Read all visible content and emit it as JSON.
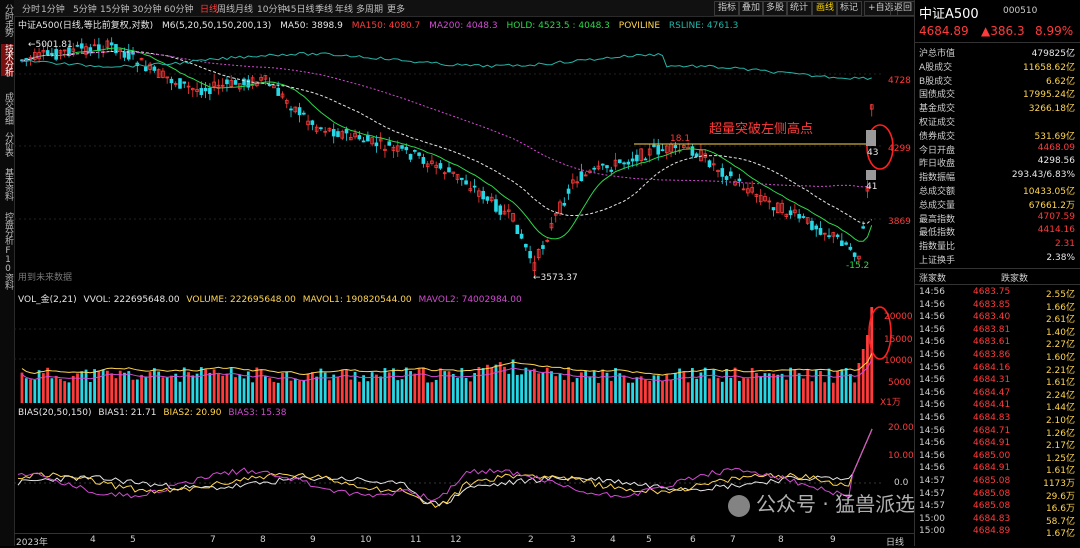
{
  "left_rail": [
    "分时走势",
    "技术分析",
    "成交明细",
    "分价表",
    "基本资料",
    "控盘分析",
    "F10资料"
  ],
  "timeframes": [
    "分时",
    "1分钟",
    "5分钟",
    "15分钟",
    "30分钟",
    "60分钟",
    "日线",
    "周线",
    "月线",
    "10分钟",
    "45日线",
    "季线",
    "年线",
    "多周期",
    "更多"
  ],
  "active_timeframe": "日线",
  "toolbar": [
    "指标",
    "叠加",
    "多股",
    "统计",
    "画线",
    "标记",
    "+自选",
    "返回"
  ],
  "main_legend": {
    "title": "中证A500(日线,等比前复权,对数)",
    "ma": "M6(5,20,50,150,200,13)",
    "ma50": "MA50: 3898.9",
    "ma150": "MA150: 4080.7",
    "ma200": "MA200: 4048.3",
    "hold": "HOLD: 4523.5 : 4048.3",
    "poviline": "POVILINE",
    "rsline": "RSLINE: 4761.3"
  },
  "main_annotations": {
    "high_label": "5001.81",
    "low_label": "3573.37",
    "callout": "超量突破左侧高点",
    "pct_top": "18.1",
    "pct_bottom": "-15.2",
    "num_43": "43",
    "num_41": "41",
    "watermark": "用到未来数据"
  },
  "main_axis": [
    "4728",
    "4299",
    "3869"
  ],
  "vol_legend": {
    "title": "VOL_金(2,21)",
    "vvol": "VVOL: 222695648.00",
    "volume": "VOLUME: 222695648.00",
    "mavol1": "MAVOL1: 190820544.00",
    "mavol2": "MAVOL2: 74002984.00"
  },
  "vol_axis": [
    "20000",
    "15000",
    "10000",
    "5000",
    "X1万"
  ],
  "bias_legend": {
    "title": "BIAS(20,50,150)",
    "b1": "BIAS1: 21.71",
    "b2": "BIAS2: 20.90",
    "b3": "BIAS3: 15.38"
  },
  "bias_axis": [
    "20.00",
    "10.00",
    "0.0"
  ],
  "x_axis": [
    "2023年",
    "4",
    "5",
    "7",
    "8",
    "9",
    "10",
    "11",
    "12",
    "2",
    "3",
    "4",
    "5",
    "6",
    "7",
    "8",
    "9"
  ],
  "x_axis_right": "日线",
  "quote": {
    "name": "中证A500",
    "code": "000510",
    "price": "4684.89",
    "change": "▲386.3",
    "pct": "8.99%"
  },
  "stats": [
    {
      "k": "沪总市值",
      "v": "479825亿",
      "c": "white"
    },
    {
      "k": "A股成交",
      "v": "11658.62亿",
      "c": "yellow"
    },
    {
      "k": "B股成交",
      "v": "6.62亿",
      "c": "yellow"
    },
    {
      "k": "国债成交",
      "v": "17995.24亿",
      "c": "yellow"
    },
    {
      "k": "基金成交",
      "v": "3266.18亿",
      "c": "yellow"
    },
    {
      "k": "权证成交",
      "v": "",
      "c": "yellow"
    },
    {
      "k": "债券成交",
      "v": "531.69亿",
      "c": "yellow"
    },
    {
      "k": "今日开盘",
      "v": "4468.09",
      "c": "red"
    },
    {
      "k": "昨日收盘",
      "v": "4298.56",
      "c": "white"
    },
    {
      "k": "指数振幅",
      "v": "293.43/6.83%",
      "c": "white"
    },
    {
      "k": "总成交额",
      "v": "10433.05亿",
      "c": "yellow"
    },
    {
      "k": "总成交量",
      "v": "67661.2万",
      "c": "yellow"
    },
    {
      "k": "最高指数",
      "v": "4707.59",
      "c": "red"
    },
    {
      "k": "最低指数",
      "v": "4414.16",
      "c": "red"
    },
    {
      "k": "指数量比",
      "v": "2.31",
      "c": "red"
    },
    {
      "k": "上证换手",
      "v": "2.38%",
      "c": "white"
    }
  ],
  "ticks_header": [
    "涨家数",
    "跌家数"
  ],
  "ticks": [
    {
      "t": "14:56",
      "p": "4683.75",
      "v": "2.55亿"
    },
    {
      "t": "14:56",
      "p": "4683.85",
      "v": "1.66亿"
    },
    {
      "t": "14:56",
      "p": "4683.40",
      "v": "2.61亿"
    },
    {
      "t": "14:56",
      "p": "4683.81",
      "v": "1.40亿"
    },
    {
      "t": "14:56",
      "p": "4683.61",
      "v": "2.27亿"
    },
    {
      "t": "14:56",
      "p": "4683.86",
      "v": "1.60亿"
    },
    {
      "t": "14:56",
      "p": "4684.16",
      "v": "2.21亿"
    },
    {
      "t": "14:56",
      "p": "4684.31",
      "v": "1.61亿"
    },
    {
      "t": "14:56",
      "p": "4684.47",
      "v": "2.24亿"
    },
    {
      "t": "14:56",
      "p": "4684.41",
      "v": "1.44亿"
    },
    {
      "t": "14:56",
      "p": "4684.83",
      "v": "2.10亿"
    },
    {
      "t": "14:56",
      "p": "4684.71",
      "v": "1.26亿"
    },
    {
      "t": "14:56",
      "p": "4684.91",
      "v": "2.17亿"
    },
    {
      "t": "14:56",
      "p": "4685.00",
      "v": "1.25亿"
    },
    {
      "t": "14:56",
      "p": "4684.91",
      "v": "1.61亿"
    },
    {
      "t": "14:57",
      "p": "4685.08",
      "v": "1173万"
    },
    {
      "t": "14:57",
      "p": "4685.08",
      "v": "29.6万"
    },
    {
      "t": "14:57",
      "p": "4685.08",
      "v": "16.6万"
    },
    {
      "t": "15:00",
      "p": "4684.83",
      "v": "58.7亿"
    },
    {
      "t": "15:00",
      "p": "4684.89",
      "v": "1.67亿"
    }
  ],
  "footer_watermark": "公众号 · 猛兽派选股",
  "chart_data": {
    "type": "candlestick",
    "high": 5001.81,
    "low": 3573.37,
    "last_close": 4684.89,
    "y_ticks": [
      3869,
      4299,
      4728
    ]
  }
}
